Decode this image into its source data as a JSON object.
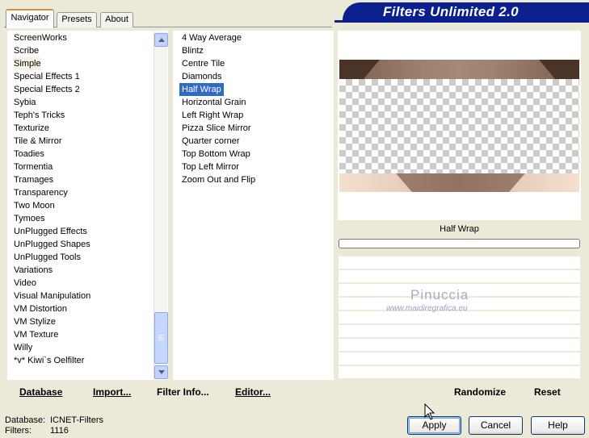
{
  "tabs": [
    "Navigator",
    "Presets",
    "About"
  ],
  "app_title": "Filters Unlimited 2.0",
  "categories": [
    "ScreenWorks",
    "Scribe",
    "Simple",
    "Special Effects 1",
    "Special Effects 2",
    "Sybia",
    "Teph's Tricks",
    "Texturize",
    "Tile & Mirror",
    "Toadies",
    "Tormentia",
    "Tramages",
    "Transparency",
    "Two Moon",
    "Tymoes",
    "UnPlugged Effects",
    "UnPlugged Shapes",
    "UnPlugged Tools",
    "Variations",
    "Video",
    "Visual Manipulation",
    "VM Distortion",
    "VM Stylize",
    "VM Texture",
    "Willy",
    "*v* Kiwi`s Oelfilter"
  ],
  "selected_category": "Simple",
  "filters": [
    "4 Way Average",
    "Blintz",
    "Centre Tile",
    "Diamonds",
    "Half Wrap",
    "Horizontal Grain",
    "Left Right Wrap",
    "Pizza Slice Mirror",
    "Quarter corner",
    "Top Bottom Wrap",
    "Top Left Mirror",
    "Zoom Out and Flip"
  ],
  "selected_filter": "Half Wrap",
  "preview": {
    "filter_name": "Half Wrap",
    "watermark_name": "Pinuccia",
    "watermark_url": "www.maidiregrafica.eu"
  },
  "toolbar": {
    "database": "Database",
    "import": "Import...",
    "filter_info": "Filter Info...",
    "editor": "Editor...",
    "randomize": "Randomize",
    "reset": "Reset"
  },
  "status": {
    "database_label": "Database:",
    "database_value": "ICNET-Filters",
    "filters_label": "Filters:",
    "filters_value": "1116"
  },
  "buttons": {
    "apply": "Apply",
    "cancel": "Cancel",
    "help": "Help"
  },
  "colors": {
    "banner": "#0b1f8f",
    "selection": "#316ac5",
    "tab_accent": "#e68b2c"
  },
  "icons": [
    "scroll-up-icon",
    "scroll-down-icon",
    "mouse-cursor-icon"
  ]
}
